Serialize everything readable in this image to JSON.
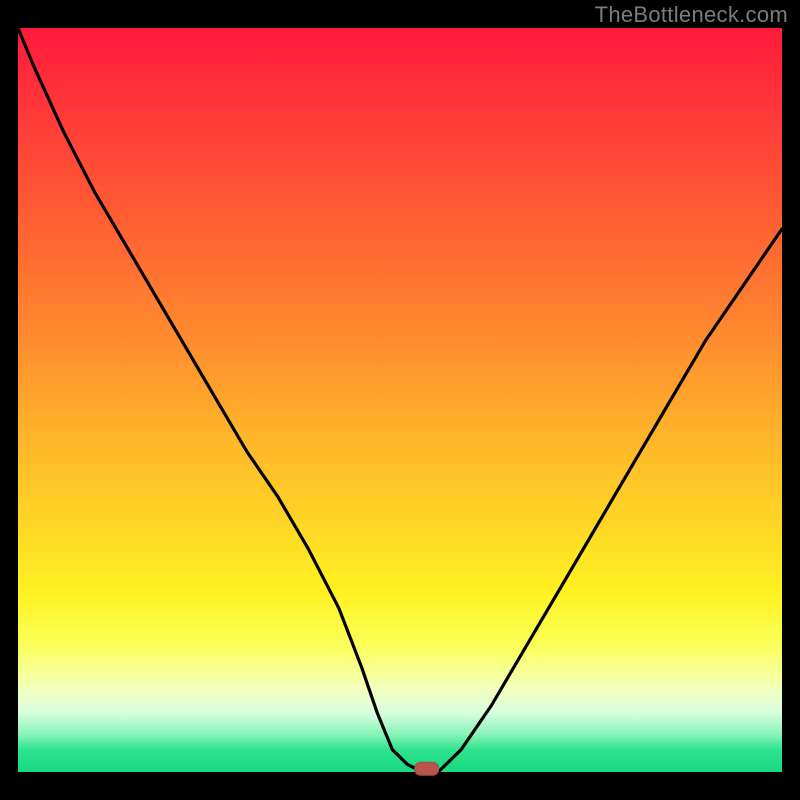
{
  "watermark": "TheBottleneck.com",
  "chart_data": {
    "type": "line",
    "title": "",
    "xlabel": "",
    "ylabel": "",
    "xlim": [
      0,
      100
    ],
    "ylim": [
      0,
      100
    ],
    "grid": false,
    "legend": null,
    "series": [
      {
        "name": "curve",
        "x": [
          0,
          2,
          6,
          10,
          14,
          18,
          22,
          26,
          30,
          34,
          38,
          42,
          45,
          47,
          49,
          51,
          53,
          55,
          58,
          62,
          66,
          70,
          74,
          78,
          82,
          86,
          90,
          94,
          98,
          100
        ],
        "values": [
          100,
          95,
          86,
          78,
          71,
          64,
          57,
          50,
          43,
          37,
          30,
          22,
          14,
          8,
          3,
          1,
          0,
          0,
          3,
          9,
          16,
          23,
          30,
          37,
          44,
          51,
          58,
          64,
          70,
          73
        ]
      }
    ],
    "marker": {
      "x": 53.5,
      "y": 0.5,
      "color": "#b7544e"
    },
    "background_gradient": {
      "top": "#ff1a3c",
      "mid": "#ffd426",
      "bottom": "#17d97f"
    }
  }
}
